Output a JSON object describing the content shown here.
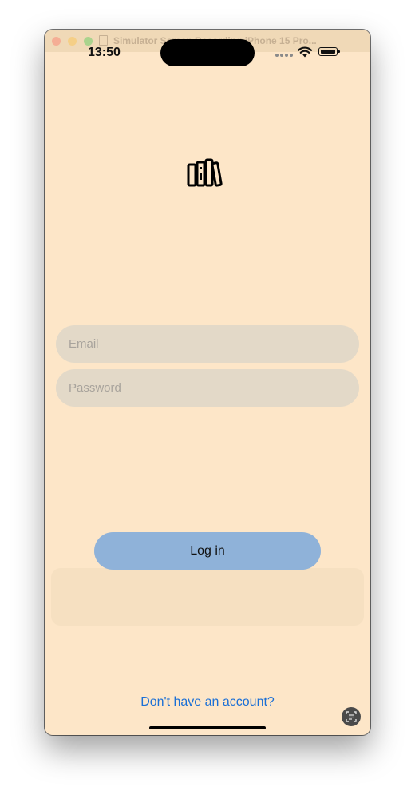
{
  "window": {
    "title": "Simulator Screen Recording iPhone 15 Pro..."
  },
  "status_bar": {
    "time": "13:50",
    "icons": [
      "cellular-dots-icon",
      "wifi-icon",
      "battery-icon"
    ]
  },
  "app": {
    "logo_icon": "books-icon",
    "email": {
      "value": "",
      "placeholder": "Email"
    },
    "password": {
      "value": "",
      "placeholder": "Password"
    },
    "login_label": "Log in",
    "signup_link": "Don't have an account?",
    "scan_icon": "live-text-icon"
  },
  "colors": {
    "background": "#fde6c8",
    "field": "#e3d9c8",
    "button": "#8fb2d9",
    "link": "#1a6fd6"
  }
}
